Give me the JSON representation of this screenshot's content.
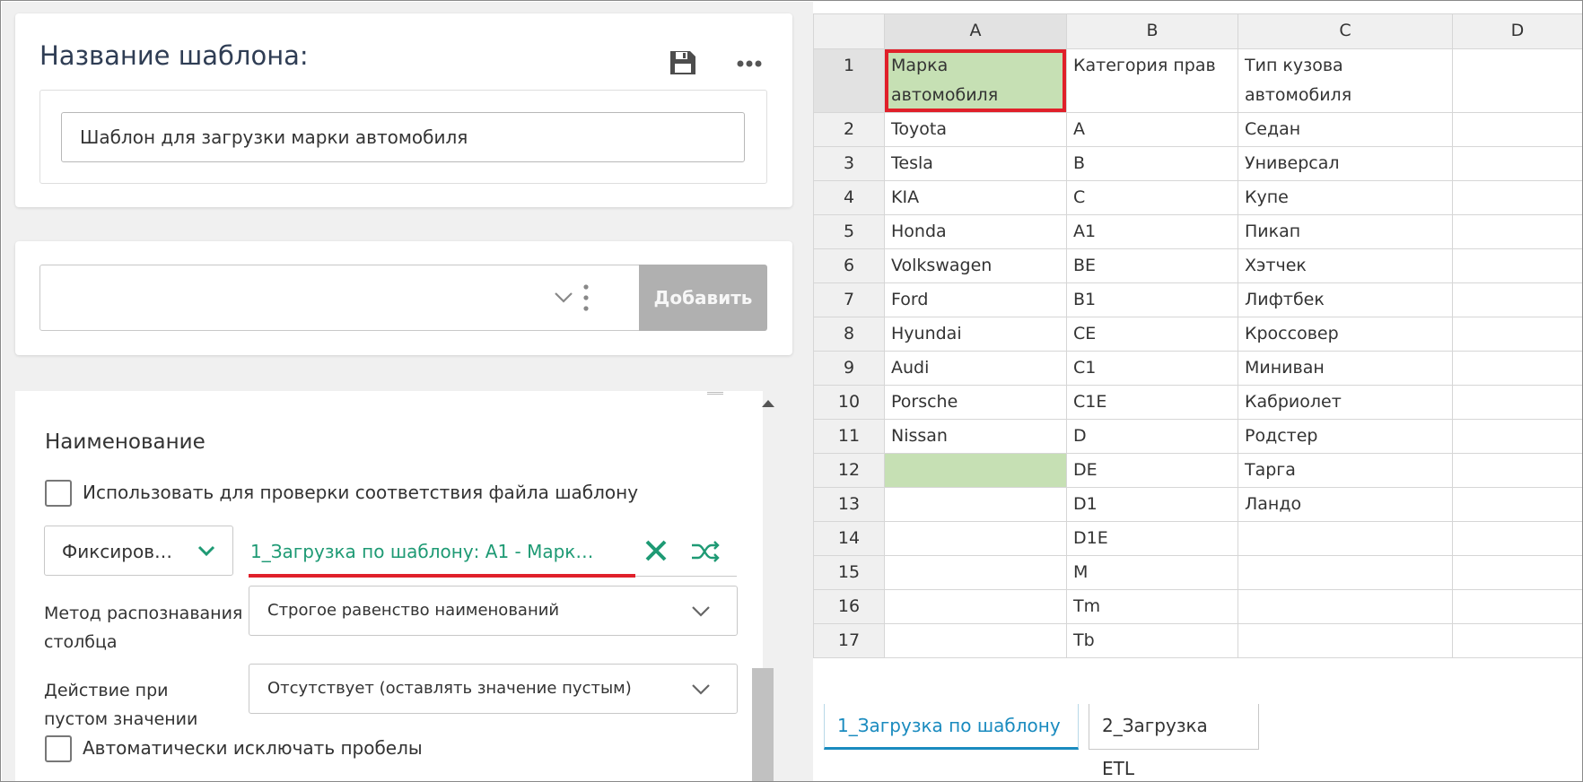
{
  "template_card": {
    "title": "Название шаблона:",
    "name_value": "Шаблон для загрузки марки автомобиля"
  },
  "add_card": {
    "select_value": "",
    "add_label": "Добавить"
  },
  "column_card": {
    "section_title": "Наименование",
    "check_file_label": "Использовать для проверки соответствия файла шаблону",
    "fixed_select_value": "Фиксиров…",
    "mapping_link": "1_Загрузка по шаблону: A1 - Марк…",
    "method_label_line1": "Метод распознавания",
    "method_label_line2": "столбца",
    "method_value": "Строгое равенство наименований",
    "empty_label_line1": "Действие при",
    "empty_label_line2": "пустом значении",
    "empty_value": "Отсутствует (оставлять значение пустым)",
    "trim_label": "Автоматически исключать пробелы"
  },
  "grid": {
    "columns": [
      "A",
      "B",
      "C",
      "D"
    ],
    "rows": [
      {
        "n": "1",
        "a_line1": "Марка",
        "a_line2": "автомобиля",
        "b": "Категория прав",
        "c_line1": "Тип кузова",
        "c_line2": "автомобиля",
        "d": ""
      },
      {
        "n": "2",
        "a": "Toyota",
        "b": "A",
        "c": "Седан",
        "d": ""
      },
      {
        "n": "3",
        "a": "Tesla",
        "b": "B",
        "c": "Универсал",
        "d": ""
      },
      {
        "n": "4",
        "a": "KIA",
        "b": "C",
        "c": "Купе",
        "d": ""
      },
      {
        "n": "5",
        "a": "Honda",
        "b": "A1",
        "c": "Пикап",
        "d": ""
      },
      {
        "n": "6",
        "a": "Volkswagen",
        "b": "BE",
        "c": "Хэтчек",
        "d": ""
      },
      {
        "n": "7",
        "a": "Ford",
        "b": "B1",
        "c": "Лифтбек",
        "d": ""
      },
      {
        "n": "8",
        "a": "Hyundai",
        "b": "CE",
        "c": "Кроссовер",
        "d": ""
      },
      {
        "n": "9",
        "a": "Audi",
        "b": "C1",
        "c": "Миниван",
        "d": ""
      },
      {
        "n": "10",
        "a": "Porsche",
        "b": "C1E",
        "c": "Кабриолет",
        "d": ""
      },
      {
        "n": "11",
        "a": "Nissan",
        "b": "D",
        "c": "Родстер",
        "d": ""
      },
      {
        "n": "12",
        "a": "",
        "b": "DE",
        "c": "Тарга",
        "d": ""
      },
      {
        "n": "13",
        "a": "",
        "b": "D1",
        "c": "Ландо",
        "d": ""
      },
      {
        "n": "14",
        "a": "",
        "b": "D1E",
        "c": "",
        "d": ""
      },
      {
        "n": "15",
        "a": "",
        "b": "M",
        "c": "",
        "d": ""
      },
      {
        "n": "16",
        "a": "",
        "b": "Tm",
        "c": "",
        "d": ""
      },
      {
        "n": "17",
        "a": "",
        "b": "Tb",
        "c": "",
        "d": ""
      }
    ]
  },
  "sheet_tabs": [
    "1_Загрузка по шаблону",
    "2_Загрузка ETL"
  ],
  "colors": {
    "accent": "#1a8bbf",
    "link_green": "#1e9a74",
    "highlight_red": "#e0202a",
    "selection_green": "#c6e0b4"
  },
  "icons": [
    "save-icon",
    "more-icon",
    "chevron-down-icon",
    "vertical-dots-icon",
    "close-icon",
    "shuffle-icon",
    "scroll-up-icon"
  ]
}
